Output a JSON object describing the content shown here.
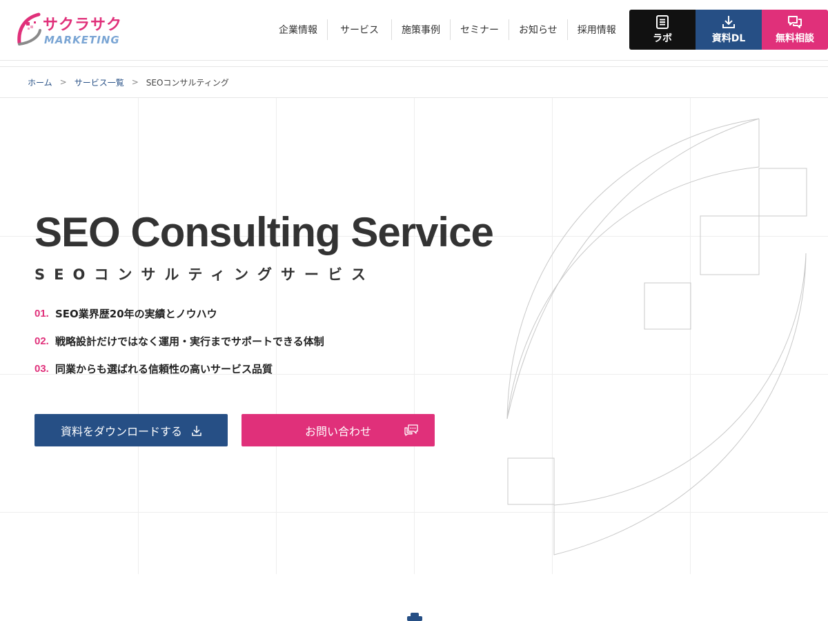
{
  "brand": {
    "name_top": "サクラサク",
    "name_bottom": "MARKETING",
    "colors": {
      "pink": "#e0307a",
      "navy": "#264f85",
      "light_blue": "#7aa5d4"
    }
  },
  "nav": {
    "items": [
      {
        "label": "企業情報"
      },
      {
        "label": "サービス"
      },
      {
        "label": "施策事例"
      },
      {
        "label": "セミナー"
      },
      {
        "label": "お知らせ"
      },
      {
        "label": "採用情報"
      }
    ]
  },
  "cta": {
    "labo": {
      "label": "ラボ",
      "icon": "document-icon"
    },
    "download": {
      "label": "資料DL",
      "icon": "download-icon"
    },
    "consult": {
      "label": "無料相談",
      "icon": "chat-bubbles-icon"
    }
  },
  "breadcrumb": {
    "items": [
      "ホーム",
      "サービス一覧",
      "SEOコンサルティング"
    ],
    "separator": ">"
  },
  "hero": {
    "title": "SEO Consulting Service",
    "subtitle": "SEOコンサルティングサービス",
    "points": [
      {
        "num": "01.",
        "text": "SEO業界歴20年の実績とノウハウ"
      },
      {
        "num": "02.",
        "text": "戦略設計だけではなく運用・実行までサポートできる体制"
      },
      {
        "num": "03.",
        "text": "同業からも選ばれる信頼性の高いサービス品質"
      }
    ],
    "download_button": "資料をダウンロードする",
    "contact_button": "お問い合わせ"
  }
}
